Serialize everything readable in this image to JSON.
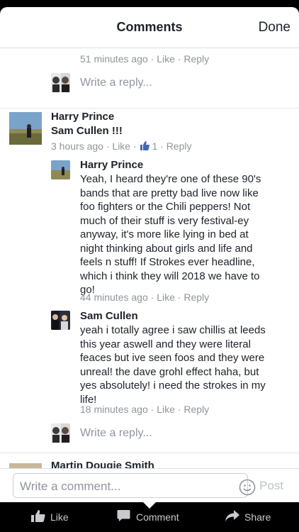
{
  "header": {
    "title": "Comments",
    "done_label": "Done"
  },
  "prev_meta": {
    "time": "51 minutes ago",
    "like": "Like",
    "reply": "Reply"
  },
  "reply_prompt_1": "Write a reply...",
  "comment_main": {
    "name": "Harry Prince",
    "text": "Sam Cullen !!!",
    "time": "3 hours ago",
    "like": "Like",
    "like_count": "1",
    "reply": "Reply"
  },
  "reply_1": {
    "name": "Harry Prince",
    "lines": [
      "Yeah, I heard they're one of these 90's",
      "bands that are pretty bad live now like",
      "foo fighters or the Chili peppers! Not",
      "much of their stuff is very festival-ey",
      "anyway, it's more like lying in bed at",
      "night thinking about girls and life and",
      "feels n stuff! If Strokes ever headline,",
      "which i think they will 2018 we have to",
      "go!"
    ],
    "time": "44 minutes ago",
    "like": "Like",
    "reply": "Reply"
  },
  "reply_2": {
    "name": "Sam Cullen",
    "lines": [
      "yeah i totally agree i saw chillis at leeds",
      "this year aswell and they were literal",
      "feaces but ive seen foos and they were",
      "unreal! the dave grohl effect haha, but",
      "yes absolutely! i need the strokes in my",
      "life!"
    ],
    "time": "18 minutes ago",
    "like": "Like",
    "reply": "Reply"
  },
  "reply_prompt_2": "Write a reply...",
  "next_comment": {
    "name": "Martin Dougie Smith"
  },
  "composer": {
    "placeholder": "Write a comment...",
    "post_label": "Post"
  },
  "tabbar": {
    "like": "Like",
    "comment": "Comment",
    "share": "Share"
  },
  "colors": {
    "meta": "#90949c",
    "text": "#1d2129",
    "like_blue": "#4267b2"
  }
}
